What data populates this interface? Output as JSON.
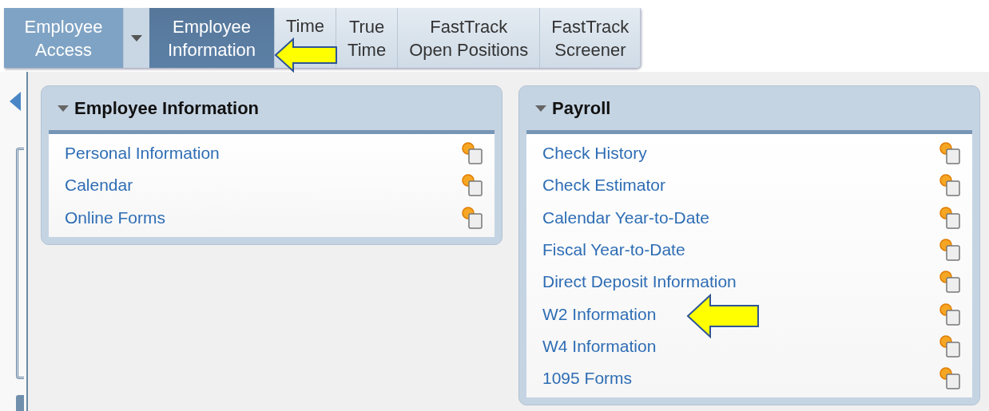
{
  "tabs": [
    {
      "kind": "tab",
      "lines": [
        "Employee",
        "Access"
      ],
      "selected": false,
      "parent": true
    },
    {
      "kind": "dropdown"
    },
    {
      "kind": "tab",
      "lines": [
        "Employee",
        "Information"
      ],
      "selected": true
    },
    {
      "kind": "tab",
      "lines": [
        "Time"
      ],
      "selected": false
    },
    {
      "kind": "tab",
      "lines": [
        "True",
        "Time"
      ],
      "selected": false
    },
    {
      "kind": "tab",
      "lines": [
        "FastTrack",
        "Open Positions"
      ],
      "selected": false
    },
    {
      "kind": "tab",
      "lines": [
        "FastTrack",
        "Screener"
      ],
      "selected": false
    }
  ],
  "panels": [
    {
      "title": "Employee Information",
      "expanded": true,
      "links": [
        "Personal Information",
        "Calendar",
        "Online Forms"
      ]
    },
    {
      "title": "Payroll",
      "expanded": true,
      "links": [
        "Check History",
        "Check Estimator",
        "Calendar Year-to-Date",
        "Fiscal Year-to-Date",
        "Direct Deposit Information",
        "W2 Information",
        "W4 Information",
        "1095 Forms"
      ]
    }
  ]
}
